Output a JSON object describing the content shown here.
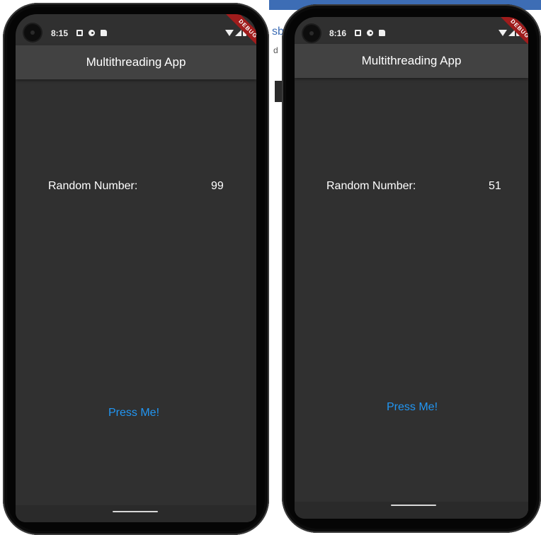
{
  "colors": {
    "screen_bg": "#303030",
    "appbar_bg": "#424242",
    "accent": "#2196f3",
    "debug_banner": "#a01c1c",
    "text": "#ffffff"
  },
  "phones": [
    {
      "status": {
        "time": "8:15",
        "icons": [
          "a-icon",
          "p-icon",
          "sd-card-icon"
        ],
        "right_icons": [
          "wifi-icon",
          "signal-icon",
          "battery-icon"
        ],
        "debug_banner": "DEBUG"
      },
      "app_title": "Multithreading App",
      "random_label": "Random Number:",
      "random_value": "99",
      "button_label": "Press Me!"
    },
    {
      "status": {
        "time": "8:16",
        "icons": [
          "a-icon",
          "p-icon",
          "sd-card-icon"
        ],
        "right_icons": [
          "wifi-icon",
          "signal-icon",
          "battery-icon"
        ],
        "debug_banner": "DEBUG"
      },
      "app_title": "Multithreading App",
      "random_label": "Random Number:",
      "random_value": "51",
      "button_label": "Press Me!"
    }
  ],
  "background": {
    "partial_text_1": "sb",
    "partial_text_2": "d"
  }
}
